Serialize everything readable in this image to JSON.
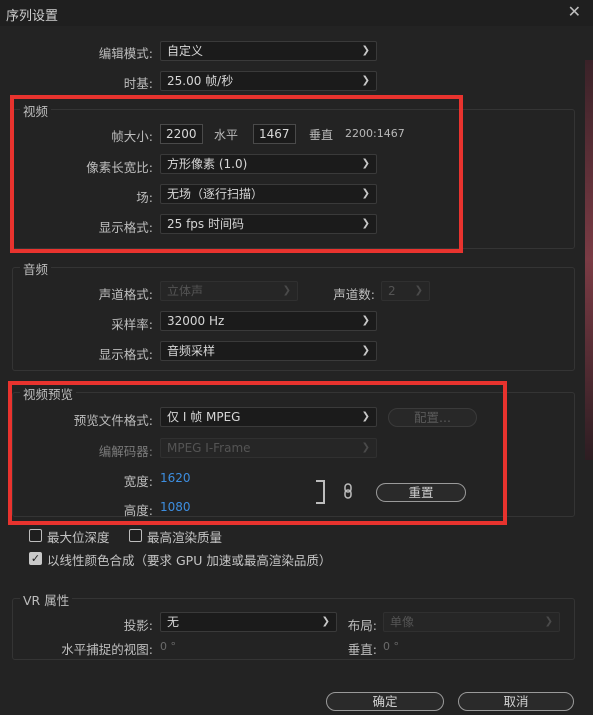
{
  "window": {
    "title": "序列设置",
    "close_glyph": "✕"
  },
  "edit_mode": {
    "label": "编辑模式:",
    "value": "自定义"
  },
  "timebase": {
    "label": "时基:",
    "value": "25.00  帧/秒"
  },
  "video": {
    "title": "视频",
    "frame_size_label": "帧大小:",
    "width": "2200",
    "horizontal_label": "水平",
    "height": "1467",
    "vertical_label": "垂直",
    "aspect_readout": "2200:1467",
    "pixel_aspect_label": "像素长宽比:",
    "pixel_aspect_value": "方形像素 (1.0)",
    "field_label": "场:",
    "field_value": "无场（逐行扫描）",
    "display_format_label": "显示格式:",
    "display_format_value": "25 fps 时间码"
  },
  "audio": {
    "title": "音频",
    "channel_format_label": "声道格式:",
    "channel_format_value": "立体声",
    "channel_count_label": "声道数:",
    "channel_count_value": "2",
    "sample_rate_label": "采样率:",
    "sample_rate_value": "32000 Hz",
    "display_format_label": "显示格式:",
    "display_format_value": "音频采样"
  },
  "preview": {
    "title": "视频预览",
    "file_format_label": "预览文件格式:",
    "file_format_value": "仅 I 帧 MPEG",
    "configure_label": "配置...",
    "codec_label": "编解码器:",
    "codec_value": "MPEG I-Frame",
    "width_label": "宽度:",
    "width_value": "1620",
    "height_label": "高度:",
    "height_value": "1080",
    "reset_label": "重置"
  },
  "options": {
    "max_bit_depth": {
      "label": "最大位深度",
      "checked": false
    },
    "max_render_quality": {
      "label": "最高渲染质量",
      "checked": false
    },
    "linear_color": {
      "label": "以线性颜色合成（要求 GPU 加速或最高渲染品质）",
      "checked": true
    }
  },
  "vr": {
    "title": "VR 属性",
    "projection_label": "投影:",
    "projection_value": "无",
    "layout_label": "布局:",
    "layout_value": "单像",
    "captured_view_label": "水平捕捉的视图:",
    "captured_view_value": "0 °",
    "vertical_label": "垂直:",
    "vertical_value": "0 °"
  },
  "footer": {
    "ok_label": "确定",
    "cancel_label": "取消"
  },
  "colors": {
    "highlight_box": "#e8332e",
    "accent_blue": "#3d8ee0"
  }
}
